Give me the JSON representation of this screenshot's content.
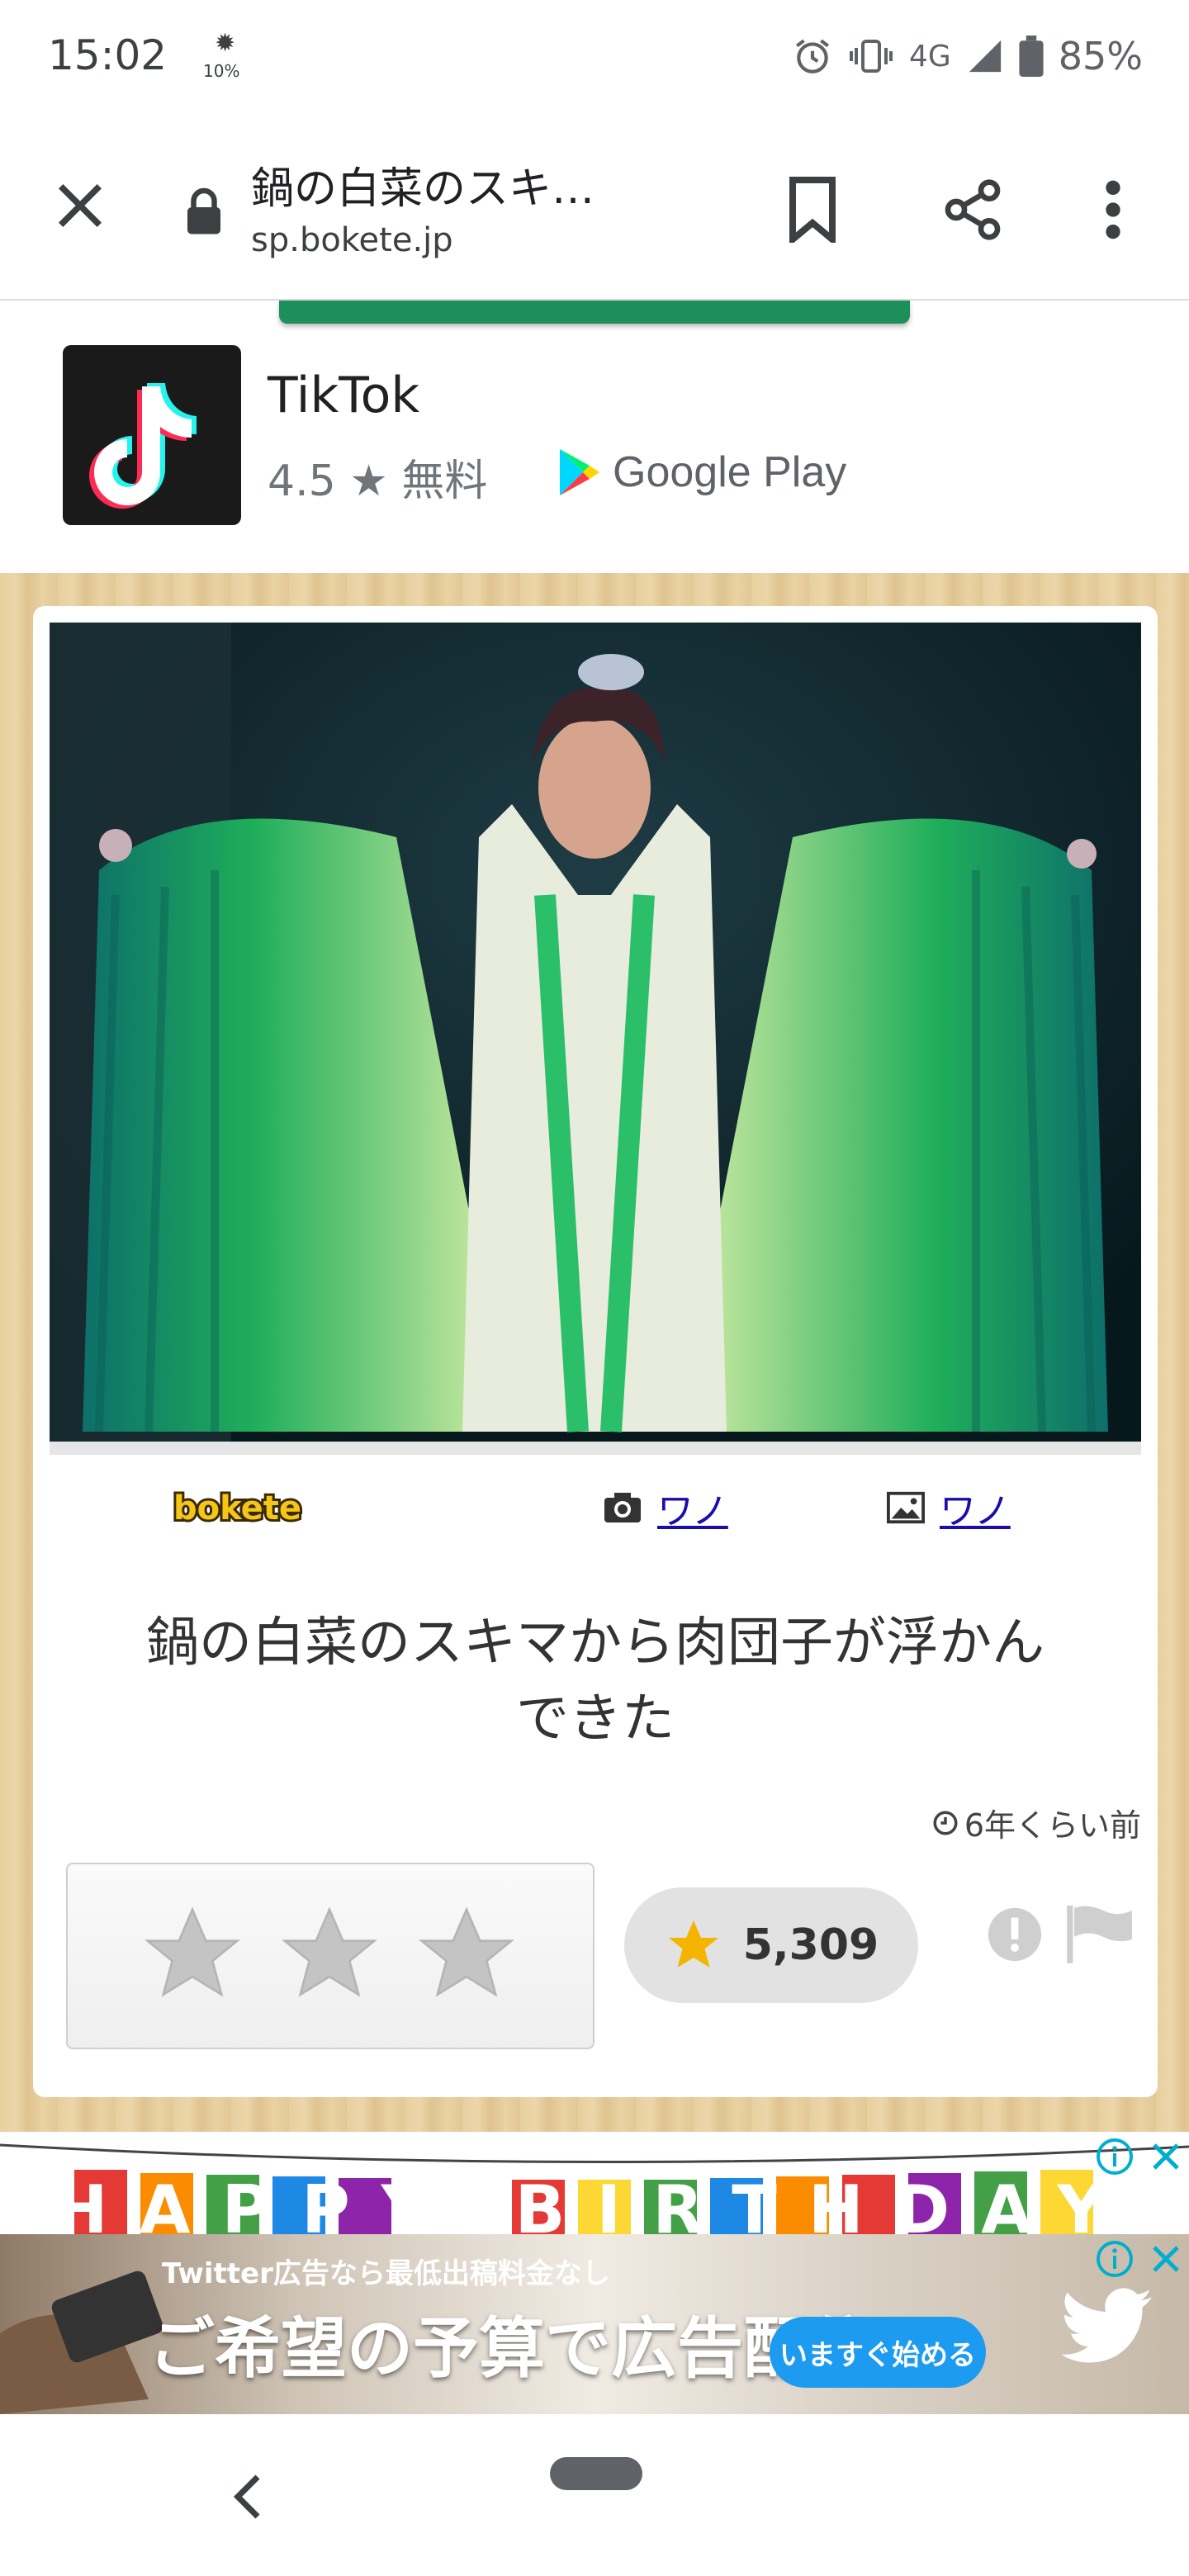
{
  "status_bar": {
    "time": "15:02",
    "brightness": "10%",
    "network": "4G",
    "battery": "85%"
  },
  "browser": {
    "title": "鍋の白菜のスキ…",
    "url": "sp.bokete.jp"
  },
  "promo": {
    "app_name": "TikTok",
    "rating": "4.5",
    "price": "無料",
    "store_label": "Google Play"
  },
  "post": {
    "logo": "bokete",
    "photographer": "ワノ",
    "uploader": "ワノ",
    "caption_line1": "鍋の白菜のスキマから肉団子が浮かん",
    "caption_line2": "できた",
    "timestamp": "6年くらい前",
    "favorites": "5,309"
  },
  "ads": {
    "banner1_text": "HAPPY BIRTHDAY",
    "banner2_small": "Twitter広告なら最低出稿料金なし",
    "banner2_big": "ご希望の予算で広告配信",
    "banner2_cta": "いますぐ始める"
  },
  "colors": {
    "promo_green": "#1e8e5a",
    "link": "#1a0dab",
    "star_gold": "#f4b400",
    "twitter_blue": "#1d9bf0"
  }
}
